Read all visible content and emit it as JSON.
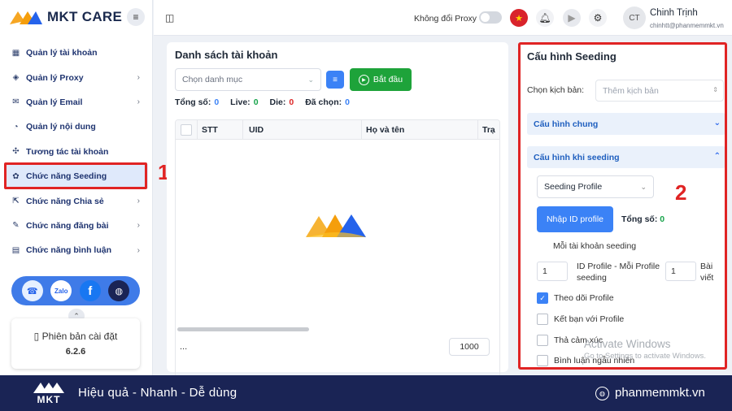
{
  "brand": {
    "name": "MKT CARE"
  },
  "sidebar": {
    "items": [
      {
        "label": "Quản lý tài khoản",
        "icon": "grid-icon",
        "chevron": false
      },
      {
        "label": "Quản lý Proxy",
        "icon": "layers-icon",
        "chevron": true
      },
      {
        "label": "Quản lý Email",
        "icon": "mail-icon",
        "chevron": true
      },
      {
        "label": "Quản lý nội dung",
        "icon": "content-icon",
        "chevron": false
      },
      {
        "label": "Tương tác tài khoản",
        "icon": "interact-icon",
        "chevron": false
      },
      {
        "label": "Chức năng Seeding",
        "icon": "seeding-icon",
        "chevron": false,
        "active": true
      },
      {
        "label": "Chức năng Chia sẻ",
        "icon": "share-icon",
        "chevron": true
      },
      {
        "label": "Chức năng đăng bài",
        "icon": "post-icon",
        "chevron": true
      },
      {
        "label": "Chức năng bình luận",
        "icon": "comment-icon",
        "chevron": true
      }
    ],
    "social": [
      "support-icon",
      "zalo-icon",
      "facebook-icon",
      "web-icon"
    ],
    "zalo_label": "Zalo",
    "facebook_label": "f",
    "version_label": "Phiên bản cài đặt",
    "version_value": "6.2.6"
  },
  "annotations": {
    "marker1": "1",
    "marker2": "2"
  },
  "topbar": {
    "proxy_label": "Không đổi Proxy",
    "avatar_initials": "CT",
    "user_name": "Chinh Trịnh",
    "user_email": "chinhtt@phanmemmkt.vn"
  },
  "accounts": {
    "title": "Danh sách tài khoản",
    "category_placeholder": "Chọn danh mục",
    "start_label": "Bắt đầu",
    "stats": {
      "total_label": "Tổng số:",
      "total": "0",
      "live_label": "Live:",
      "live": "0",
      "die_label": "Die:",
      "die": "0",
      "selected_label": "Đã chọn:",
      "selected": "0"
    },
    "columns": [
      "STT",
      "UID",
      "Họ và tên",
      "Trạ"
    ],
    "pagination_dots": "...",
    "page_size": "1000"
  },
  "seeding": {
    "title": "Cấu hình Seeding",
    "scenario_label": "Chọn kịch bản:",
    "scenario_placeholder": "Thêm kịch bản",
    "general_config": "Cấu hình chung",
    "seeding_config": "Cấu hình khi seeding",
    "mode_select": "Seeding Profile",
    "import_label": "Nhập ID profile",
    "total_label": "Tổng số:",
    "total_value": "0",
    "each_account_label": "Mỗi tài khoản seeding",
    "id_per_profile_value": "1",
    "id_per_profile_label": "ID Profile - Mỗi Profile seeding",
    "posts_value": "1",
    "posts_label": "Bài viết",
    "options": [
      {
        "label": "Theo dõi Profile",
        "checked": true
      },
      {
        "label": "Kết bạn với Profile",
        "checked": false
      },
      {
        "label": "Thả cảm xúc",
        "checked": false
      },
      {
        "label": "Bình luận ngẫu nhiên",
        "checked": false
      }
    ]
  },
  "watermark": {
    "line1": "Activate Windows",
    "line2": "Go to Settings to activate Windows."
  },
  "footer": {
    "logo_text": "MKT",
    "slogan": "Hiệu quả - Nhanh - Dễ dùng",
    "website": "phanmemmkt.vn"
  },
  "colors": {
    "accent": "#3b82f6",
    "start": "#1ea33a",
    "annotation": "#e02424",
    "footer": "#1a2455"
  }
}
